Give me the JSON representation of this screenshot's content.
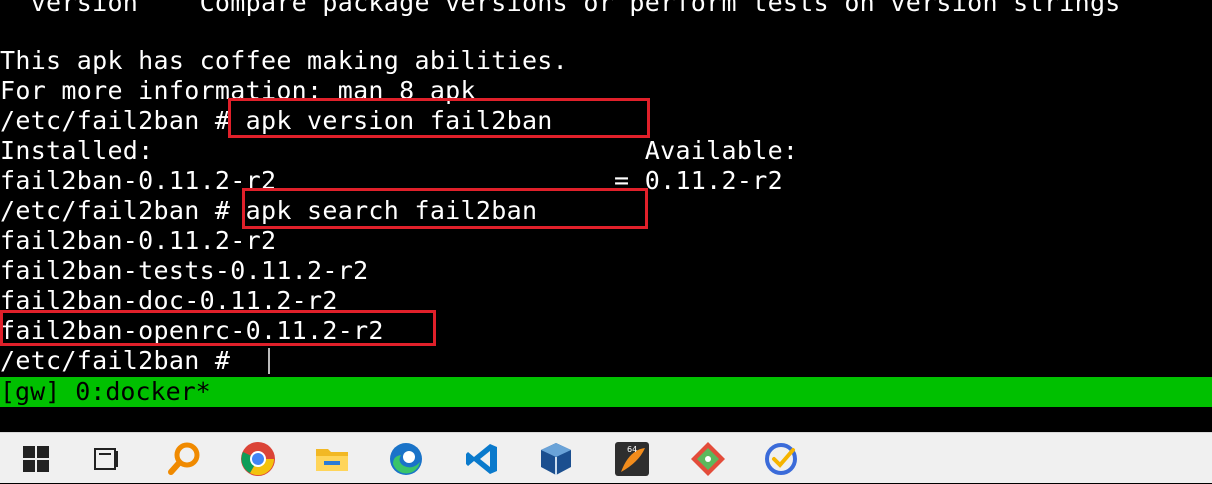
{
  "terminal": {
    "lines": [
      "  version    Compare package versions or perform tests on version strings",
      "",
      "This apk has coffee making abilities.",
      "For more information: man 8 apk",
      "/etc/fail2ban # apk version fail2ban",
      "Installed:                                Available:",
      "fail2ban-0.11.2-r2                      = 0.11.2-r2",
      "/etc/fail2ban # apk search fail2ban",
      "fail2ban-0.11.2-r2",
      "fail2ban-tests-0.11.2-r2",
      "fail2ban-doc-0.11.2-r2",
      "fail2ban-openrc-0.11.2-r2",
      "/etc/fail2ban # "
    ],
    "status_bar": "[gw] 0:docker*",
    "status_bar_color": "#00c000",
    "highlight_color": "#e0202a"
  },
  "taskbar": {
    "icons": [
      "windows-start-icon",
      "task-view-icon",
      "search-magnifier-icon",
      "chrome-icon",
      "file-explorer-icon",
      "edge-icon",
      "vscode-icon",
      "virtualbox-icon",
      "app-64-icon",
      "git-icon",
      "todo-check-icon"
    ]
  }
}
